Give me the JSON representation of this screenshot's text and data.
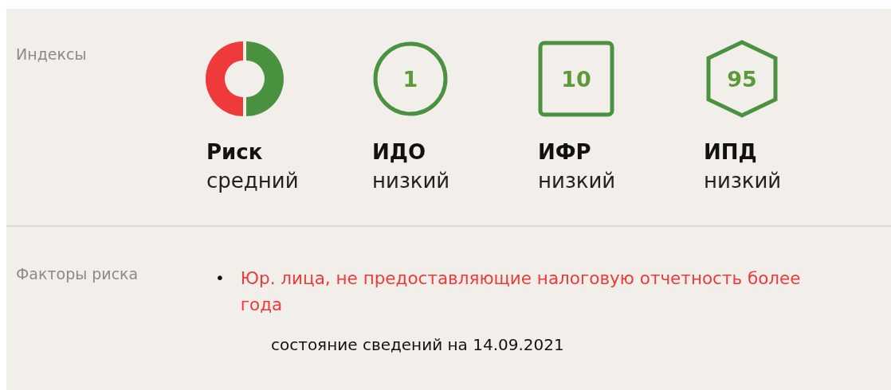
{
  "indexes": {
    "label": "Индексы",
    "items": [
      {
        "kind": "donut",
        "value": null,
        "title": "Риск",
        "level_text": "средний"
      },
      {
        "kind": "circle",
        "value": "1",
        "title": "ИДО",
        "level_text": "низкий"
      },
      {
        "kind": "square",
        "value": "10",
        "title": "ИФР",
        "level_text": "низкий"
      },
      {
        "kind": "hexagon",
        "value": "95",
        "title": "ИПД",
        "level_text": "низкий"
      }
    ]
  },
  "risk_factors": {
    "label": "Факторы риска",
    "items": [
      {
        "marker": "•",
        "text": "Юр. лица, не предоставляющие налоговую отчетность более года"
      }
    ],
    "status": "состояние сведений на 14.09.2021"
  }
}
